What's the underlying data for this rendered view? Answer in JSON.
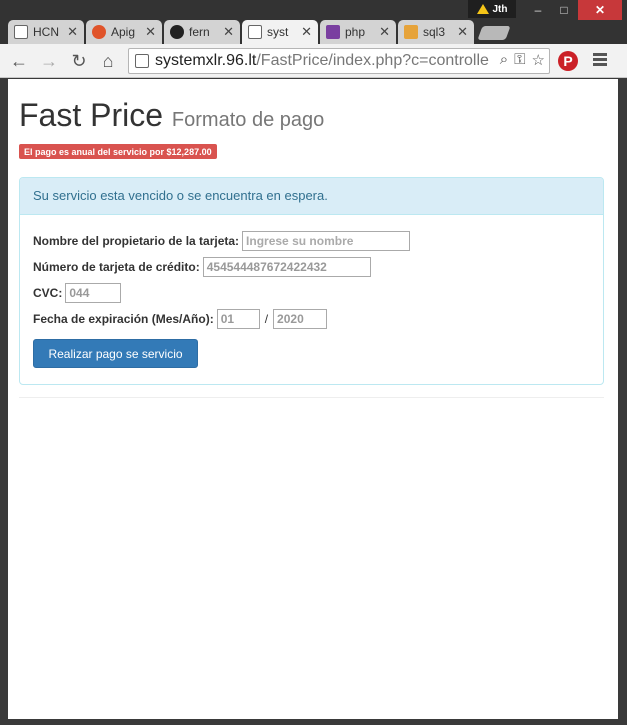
{
  "window": {
    "profile_name": "Jth",
    "controls": {
      "minimize": "–",
      "maximize": "□",
      "close": "✕"
    }
  },
  "tabs": [
    {
      "label": "HCN",
      "icon": "document-icon",
      "active": false
    },
    {
      "label": "Apig",
      "icon": "apigee-icon",
      "active": false
    },
    {
      "label": "fern",
      "icon": "github-icon",
      "active": false
    },
    {
      "label": "syst",
      "icon": "document-icon",
      "active": true
    },
    {
      "label": "php",
      "icon": "php-icon",
      "active": false
    },
    {
      "label": "sql3",
      "icon": "phpmyadmin-icon",
      "active": false
    }
  ],
  "toolbar": {
    "url_host": "systemxlr.96.lt",
    "url_path": "/FastPrice/index.php?c=controlle"
  },
  "page": {
    "title": "Fast Price",
    "subtitle": "Formato de pago",
    "badge": "El pago es anual del servicio por $12,287.00",
    "alert": "Su servicio esta vencido o se encuentra en espera.",
    "form": {
      "owner_label": "Nombre del propietario de la tarjeta:",
      "owner_placeholder": "Ingrese su nombre",
      "card_label": "Número de tarjeta de crédito:",
      "card_value": "454544487672422432",
      "cvc_label": "CVC:",
      "cvc_value": "044",
      "expiry_label": "Fecha de expiración (Mes/Año):",
      "month_value": "01",
      "separator": "/",
      "year_value": "2020",
      "submit_label": "Realizar pago se servicio"
    }
  },
  "colors": {
    "primary": "#337ab7",
    "danger": "#d9534f",
    "info_bg": "#d9edf7",
    "info_text": "#31708f"
  }
}
